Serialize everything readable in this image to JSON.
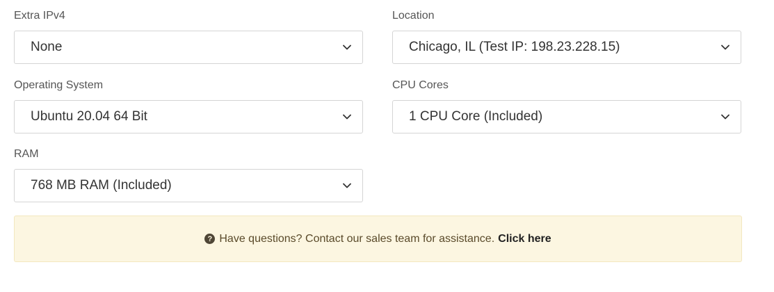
{
  "fields": {
    "extra_ipv4": {
      "label": "Extra IPv4",
      "value": "None"
    },
    "location": {
      "label": "Location",
      "value": "Chicago, IL (Test IP: 198.23.228.15)"
    },
    "operating_system": {
      "label": "Operating System",
      "value": "Ubuntu 20.04 64 Bit"
    },
    "cpu_cores": {
      "label": "CPU Cores",
      "value": "1 CPU Core (Included)"
    },
    "ram": {
      "label": "RAM",
      "value": "768 MB RAM (Included)"
    }
  },
  "alert": {
    "icon": "question-circle-icon",
    "icon_glyph": "?",
    "text": "Have questions? Contact our sales team for assistance.",
    "link_text": "Click here"
  },
  "colors": {
    "alert_background": "#fcf6e1",
    "alert_border": "#f3e7bf",
    "select_border": "#d4d4d4"
  }
}
